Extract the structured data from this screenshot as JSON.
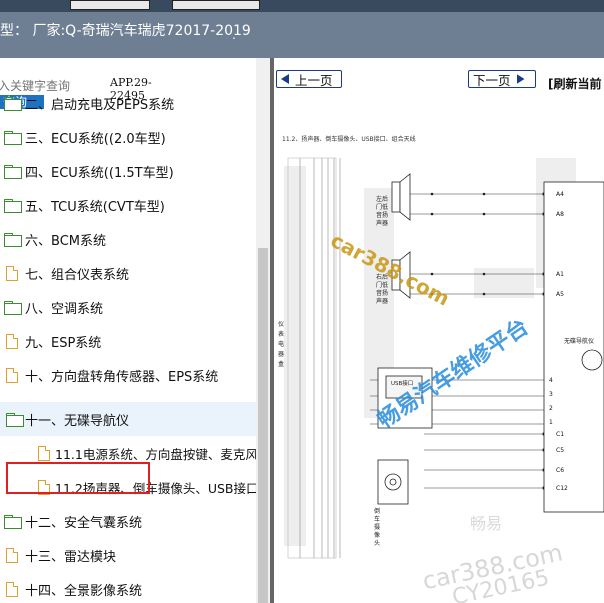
{
  "title_bar": {
    "title": "型：  厂家:Q-奇瑞汽车瑞虎72017-2019",
    "dot": "."
  },
  "search": {
    "placeholder": "入关键字查询",
    "button_label": "查询",
    "app_version": "APP.29-22495"
  },
  "tree": {
    "items": [
      {
        "label": "二、启动充电及PEPS系统",
        "icon": "folder-icon"
      },
      {
        "label": "三、ECU系统((2.0车型)",
        "icon": "folder-icon"
      },
      {
        "label": "四、ECU系统((1.5T车型)",
        "icon": "folder-icon"
      },
      {
        "label": "五、TCU系统(CVT车型)",
        "icon": "folder-icon"
      },
      {
        "label": "六、BCM系统",
        "icon": "folder-icon"
      },
      {
        "label": "七、组合仪表系统",
        "icon": "doc-icon"
      },
      {
        "label": "八、空调系统",
        "icon": "folder-icon"
      },
      {
        "label": "九、ESP系统",
        "icon": "doc-icon"
      },
      {
        "label": "十、方向盘转角传感器、EPS系统",
        "icon": "doc-icon"
      },
      {
        "label": "十一、无碟导航仪",
        "icon": "folder-open-icon",
        "selected": true
      },
      {
        "label": "11.1电源系统、方向盘按键、麦克风",
        "icon": "doc-icon",
        "child": true
      },
      {
        "label": "11.2扬声器、倒车摄像头、USB接口",
        "icon": "doc-icon",
        "child": true
      },
      {
        "label": "十二、安全气囊系统",
        "icon": "folder-icon"
      },
      {
        "label": "十三、雷达模块",
        "icon": "doc-icon"
      },
      {
        "label": "十四、全景影像系统",
        "icon": "doc-icon"
      }
    ]
  },
  "viewer": {
    "prev_label": "上一页",
    "next_label": "下一页",
    "refresh_label": "[刷新当前"
  },
  "document": {
    "heading": "11.2、扬声器、倒车摄像头、USB接口、组合天线",
    "component_labels": {
      "left_rear_speaker": "左后门低音扬声器",
      "right_rear_speaker": "右后门低音扬声器",
      "instrument_panel": "仪表电器盒",
      "rear_camera": "倒车摄像头",
      "usb": "USB接口",
      "nav_unit": "无碟导航仪"
    },
    "connector_pins": [
      "A4",
      "A8",
      "A1",
      "A5",
      "4",
      "3",
      "2",
      "1",
      "C1",
      "C5",
      "C6",
      "C12"
    ],
    "watermarks": [
      "car388.com",
      "畅易汽车维修平台",
      "畅易",
      "car388.com",
      "CY20165"
    ]
  },
  "colors": {
    "title_bar_bg": "#6e7f93",
    "search_button_bg": "#1e72c2",
    "highlight_border": "#e02020",
    "folder_icon": "#3a8d2e",
    "doc_icon": "#e0a030",
    "nav_button_border": "#1b3b88"
  }
}
